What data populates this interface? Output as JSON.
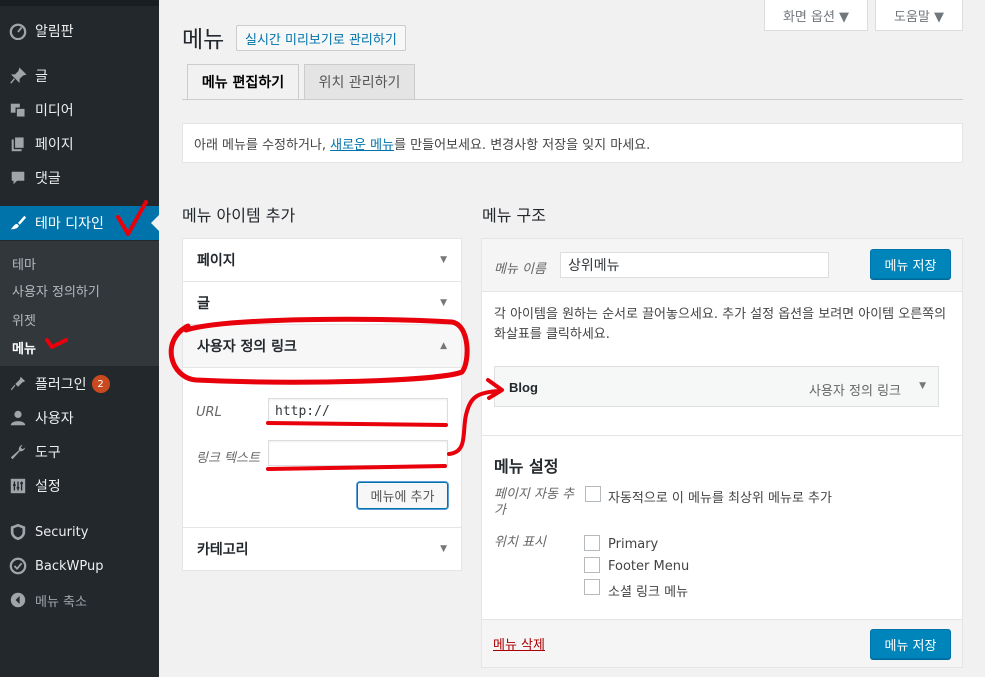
{
  "sidebar": {
    "items": [
      {
        "label": "알림판",
        "icon": "dashboard-icon"
      },
      {
        "label": "글",
        "icon": "pin-icon"
      },
      {
        "label": "미디어",
        "icon": "media-icon"
      },
      {
        "label": "페이지",
        "icon": "page-icon"
      },
      {
        "label": "댓글",
        "icon": "comment-icon"
      },
      {
        "label": "테마 디자인",
        "icon": "brush-icon"
      },
      {
        "label": "플러그인",
        "icon": "plugin-icon",
        "badge": "2"
      },
      {
        "label": "사용자",
        "icon": "user-icon"
      },
      {
        "label": "도구",
        "icon": "wrench-icon"
      },
      {
        "label": "설정",
        "icon": "settings-icon"
      },
      {
        "label": "Security",
        "icon": "shield-icon"
      },
      {
        "label": "BackWPup",
        "icon": "backup-icon"
      },
      {
        "label": "메뉴 축소",
        "icon": "collapse-icon"
      }
    ],
    "submenu": [
      "테마",
      "사용자 정의하기",
      "위젯",
      "메뉴"
    ]
  },
  "screen_options": {
    "label": "화면 옵션 ▼",
    "help": "도움말 ▼"
  },
  "header": {
    "title": "메뉴",
    "live_button": "실시간 미리보기로 관리하기"
  },
  "tabs": [
    "메뉴 편집하기",
    "위치 관리하기"
  ],
  "notice": {
    "before": "아래 메뉴를 수정하거나, ",
    "link": "새로운 메뉴",
    "after": "를 만들어보세요. 변경사항 저장을 잊지 마세요."
  },
  "left": {
    "heading": "메뉴 아이템 추가",
    "sections": [
      "페이지",
      "글",
      "사용자 정의 링크",
      "카테고리"
    ],
    "url_label": "URL",
    "url_value": "http://",
    "text_label": "링크 텍스트",
    "text_value": "",
    "add_button": "메뉴에 추가"
  },
  "right": {
    "heading": "메뉴 구조",
    "name_label": "메뉴 이름",
    "name_value": "상위메뉴",
    "save_button": "메뉴 저장",
    "instructions": "각 아이템을 원하는 순서로 끌어놓으세요. 추가 설정 옵션을 보려면 아이템 오른쪽의 화살표를 클릭하세요.",
    "menu_item": {
      "title": "Blog",
      "type": "사용자 정의 링크"
    },
    "settings_heading": "메뉴 설정",
    "auto_add_label": "페이지 자동 추가",
    "auto_add_option": "자동적으로 이 메뉴를 최상위 메뉴로 추가",
    "location_label": "위치 표시",
    "locations": [
      "Primary",
      "Footer Menu",
      "소셜 링크 메뉴"
    ],
    "delete_link": "메뉴 삭제"
  },
  "colors": {
    "sidebar": "#23282d",
    "accent": "#0073aa",
    "annotation": "#e8000b"
  }
}
